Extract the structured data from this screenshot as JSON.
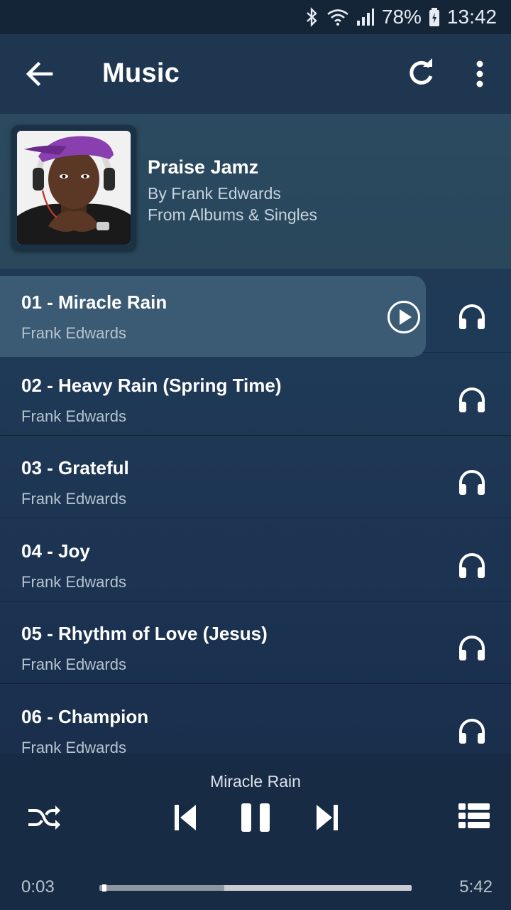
{
  "status_bar": {
    "battery": "78%",
    "time": "13:42",
    "icons": [
      "bluetooth-icon",
      "wifi-icon",
      "signal-icon",
      "battery-icon"
    ]
  },
  "app_bar": {
    "title": "Music",
    "icons": [
      "back-arrow-icon",
      "refresh-icon",
      "more-vert-icon"
    ]
  },
  "album": {
    "name": "Praise Jamz",
    "artist_line": "By Frank Edwards",
    "source_line": "From Albums & Singles"
  },
  "tracks": [
    {
      "title": "01 - Miracle Rain",
      "artist": "Frank Edwards",
      "active": true
    },
    {
      "title": "02 - Heavy Rain (Spring Time)",
      "artist": "Frank Edwards"
    },
    {
      "title": "03 - Grateful",
      "artist": "Frank Edwards"
    },
    {
      "title": "04 - Joy",
      "artist": "Frank Edwards"
    },
    {
      "title": "05 - Rhythm of Love (Jesus)",
      "artist": "Frank Edwards"
    },
    {
      "title": "06 - Champion",
      "artist": "Frank Edwards"
    }
  ],
  "player": {
    "now_playing": "Miracle Rain",
    "current_time": "0:03",
    "total_time": "5:42",
    "progress_fraction": 0.009,
    "buffer_fraction": 0.4
  },
  "colors": {
    "background": "#1f3a56",
    "highlight_row": "#3b5a74",
    "player_bg": "#172b44"
  }
}
